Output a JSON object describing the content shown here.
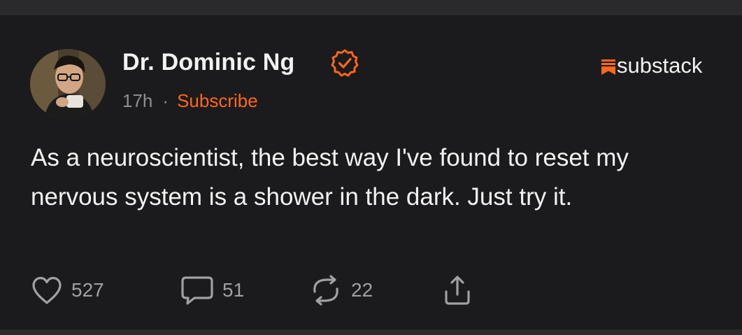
{
  "post": {
    "author": {
      "name": "Dr. Dominic Ng",
      "verified_icon": "verified-check-icon",
      "avatar_icon": "avatar"
    },
    "time": "17h",
    "separator": "·",
    "subscribe_label": "Subscribe",
    "brand": {
      "name": "substack",
      "icon": "substack-logo-icon",
      "color": "#ff6719"
    },
    "text": "As a neuroscientist, the best way I've found to reset my nervous system is a shower in the dark. Just try it.",
    "actions": {
      "likes": "527",
      "comments": "51",
      "restacks": "22",
      "like_icon": "heart-icon",
      "comment_icon": "comment-icon",
      "restack_icon": "restack-icon",
      "share_icon": "share-icon"
    }
  },
  "colors": {
    "background": "#1b1b1d",
    "accent": "#ff6719",
    "text": "#f2f2f2",
    "muted": "#8e8e93"
  }
}
